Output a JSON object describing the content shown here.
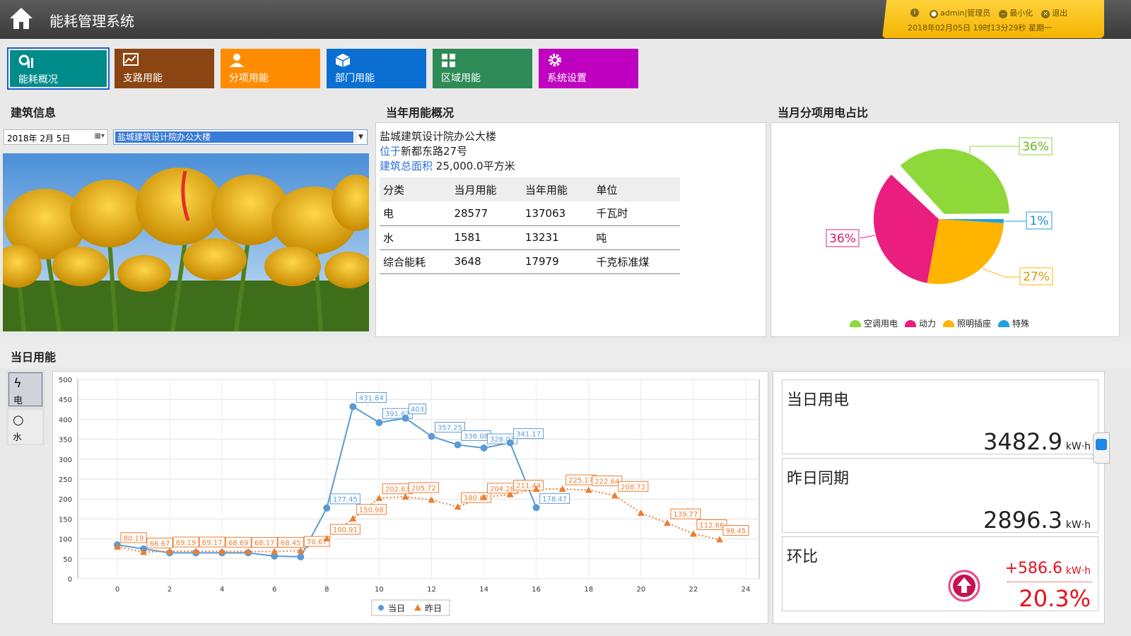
{
  "app": {
    "title": "能耗管理系统"
  },
  "user": {
    "help_icon": "info-icon",
    "user_label": "admin|管理员",
    "minimize_label": "最小化",
    "exit_label": "退出",
    "datetime": "2018年02月05日 19时13分29秒 星期一"
  },
  "nav": [
    {
      "label": "能耗概况",
      "icon": "overview-icon",
      "color": "#008b8b"
    },
    {
      "label": "支路用能",
      "icon": "branch-chart-icon",
      "color": "#8b4513"
    },
    {
      "label": "分项用能",
      "icon": "user-icon",
      "color": "#ff8c00"
    },
    {
      "label": "部门用能",
      "icon": "cube-icon",
      "color": "#0a6fd1"
    },
    {
      "label": "区域用能",
      "icon": "grid-icon",
      "color": "#2e8b57"
    },
    {
      "label": "系统设置",
      "icon": "gear-icon",
      "color": "#c000c0"
    }
  ],
  "building": {
    "section_title": "建筑信息",
    "date_value": "2018年  2月  5日",
    "selected_building": "盐城建筑设计院办公大楼"
  },
  "year": {
    "section_title": "当年用能概况",
    "name": "盐城建筑设计院办公大楼",
    "addr_label": "位于",
    "addr_value": "新都东路27号",
    "area_label": "建筑总面积",
    "area_value": "25,000.0平方米",
    "columns": [
      "分类",
      "当月用能",
      "当年用能",
      "单位"
    ],
    "rows": [
      [
        "电",
        "28577",
        "137063",
        "千瓦时"
      ],
      [
        "水",
        "1581",
        "13231",
        "吨"
      ],
      [
        "综合能耗",
        "3648",
        "17979",
        "千克标准煤"
      ]
    ]
  },
  "pie": {
    "section_title": "当月分项用电占比",
    "labels": [
      "36%",
      "1%",
      "27%",
      "36%"
    ],
    "legend": [
      "空调用电",
      "动力",
      "照明插座",
      "特殊"
    ],
    "colors": [
      "#8ed83a",
      "#e91e7e",
      "#ffb400",
      "#1ea0e0"
    ]
  },
  "daily": {
    "section_title": "当日用能",
    "tab_elec": "电",
    "tab_water": "水"
  },
  "chart_data": {
    "type": "line",
    "x": [
      0,
      1,
      2,
      3,
      4,
      5,
      6,
      7,
      8,
      9,
      10,
      11,
      12,
      13,
      14,
      15,
      16,
      17,
      18,
      19,
      20,
      21,
      22,
      23
    ],
    "xlim": [
      0,
      24
    ],
    "ylim": [
      0,
      500
    ],
    "xticks": [
      0,
      2,
      4,
      6,
      8,
      10,
      12,
      14,
      16,
      18,
      20,
      22,
      24
    ],
    "yticks": [
      0,
      50,
      100,
      150,
      200,
      250,
      300,
      350,
      400,
      450,
      500
    ],
    "grid": true,
    "legend_position": "bottom",
    "series": [
      {
        "name": "当日",
        "color": "#5b9bd5",
        "values": [
          85,
          75,
          65,
          65,
          65,
          65,
          57,
          55,
          177.45,
          431.84,
          391.67,
          403,
          357.25,
          336.08,
          328.03,
          341.17,
          178.47,
          null,
          null,
          null,
          null,
          null,
          null,
          null
        ],
        "labels": [
          null,
          null,
          null,
          null,
          null,
          null,
          null,
          null,
          "177.45",
          "431.84",
          "391.67",
          "403",
          "357.25",
          "336.08",
          "328.03",
          "341.17",
          "178.47",
          null,
          null,
          null,
          null,
          null,
          null,
          null
        ]
      },
      {
        "name": "昨日",
        "color": "#ed7d31",
        "values": [
          80.19,
          66.67,
          69.19,
          69.17,
          68.69,
          68.17,
          68.45,
          70.67,
          100.91,
          150.98,
          202.63,
          205.72,
          198,
          180.67,
          204.28,
          211.44,
          225,
          225.17,
          222.64,
          208.72,
          165,
          139.77,
          112.66,
          98.45
        ],
        "labels": [
          "80.19",
          "66.67",
          "69.19",
          "69.17",
          "68.69",
          "68.17",
          "68.45",
          "70.67",
          "100.91",
          "150.98",
          "202.63",
          "205.72",
          null,
          "180.67",
          "204.28",
          "211.44",
          null,
          "225.17",
          "222.64",
          "208.72",
          null,
          "139.77",
          "112.66",
          "98.45"
        ]
      }
    ]
  },
  "stats": {
    "today_label": "当日用电",
    "today_value": "3482.9",
    "yesterday_label": "昨日同期",
    "yesterday_value": "2896.3",
    "unit": "kW·h",
    "ratio_label": "环比",
    "diff_value": "+586.6",
    "ratio_value": "20.3%"
  }
}
